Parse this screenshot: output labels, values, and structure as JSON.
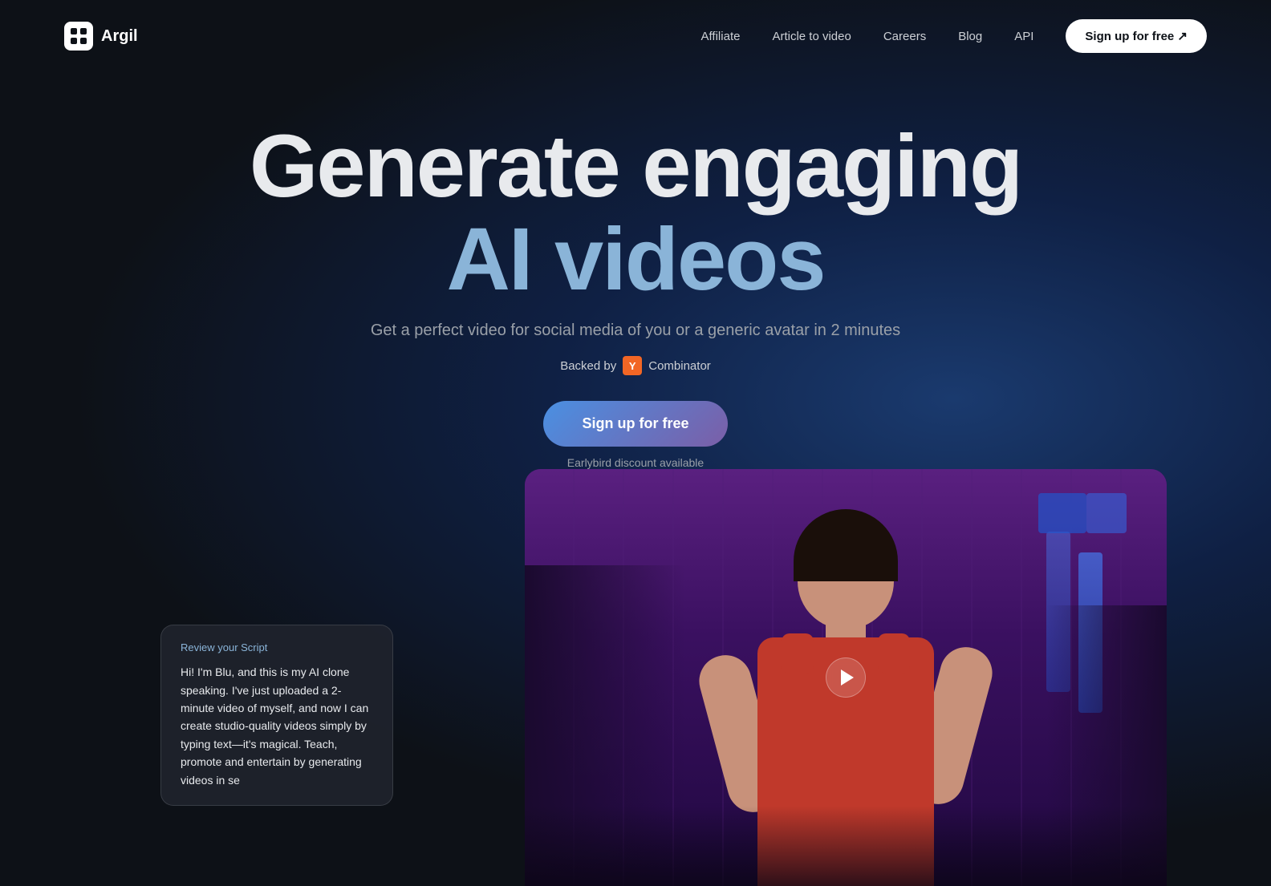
{
  "page": {
    "background": "#0d1117"
  },
  "navbar": {
    "logo_text": "Argil",
    "links": [
      {
        "label": "Affiliate",
        "id": "affiliate"
      },
      {
        "label": "Article to video",
        "id": "article-to-video"
      },
      {
        "label": "Careers",
        "id": "careers"
      },
      {
        "label": "Blog",
        "id": "blog"
      },
      {
        "label": "API",
        "id": "api"
      }
    ],
    "cta_label": "Sign up for free ↗"
  },
  "hero": {
    "title_line1": "Generate engaging",
    "title_line2": "AI videos",
    "subtitle": "Get a perfect video for social media of you or a generic avatar in 2 minutes",
    "backed_by_text": "Backed by",
    "yc_label": "Y",
    "combinator_text": "Combinator",
    "cta_label": "Sign up for free",
    "earlybird_text": "Earlybird discount available"
  },
  "script_card": {
    "title": "Review your Script",
    "body": "Hi! I'm Blu, and this is my AI clone speaking. I've just uploaded a 2-minute video of myself, and now I can create studio-quality videos simply by typing text—it's magical. Teach, promote and entertain by generating videos in se"
  },
  "video": {
    "play_button_label": "Play video"
  }
}
